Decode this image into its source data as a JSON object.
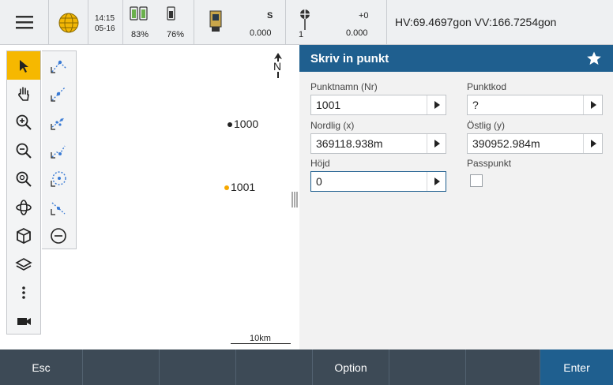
{
  "status": {
    "time": "14:15",
    "date": "05-16",
    "battery1_pct": "83%",
    "battery2_pct": "76%",
    "station_s_label": "S",
    "station_s_value": "0.000",
    "target_plus": "+0",
    "target_height_label": "1",
    "target_value": "0.000",
    "angles": "HV:69.4697gon VV:166.7254gon"
  },
  "map": {
    "north_label": "N",
    "points": [
      {
        "label": "1000",
        "color": "#222222"
      },
      {
        "label": "1001",
        "color": "#f6a800"
      }
    ],
    "scale_label": "10km"
  },
  "form": {
    "title": "Skriv in punkt",
    "fields": {
      "punktnamn": {
        "label": "Punktnamn (Nr)",
        "value": "1001"
      },
      "punktkod": {
        "label": "Punktkod",
        "value": "?"
      },
      "nordlig": {
        "label": "Nordlig (x)",
        "value": "369118.938m"
      },
      "ostlig": {
        "label": "Östlig (y)",
        "value": "390952.984m"
      },
      "hojd": {
        "label": "Höjd",
        "value": "0"
      },
      "passpunkt": {
        "label": "Passpunkt",
        "checked": false
      }
    }
  },
  "bottom": {
    "esc": "Esc",
    "option": "Option",
    "enter": "Enter"
  },
  "colors": {
    "accent": "#1f5f8f",
    "tool_active": "#f6b800",
    "bottom_bar": "#3d4a56"
  }
}
